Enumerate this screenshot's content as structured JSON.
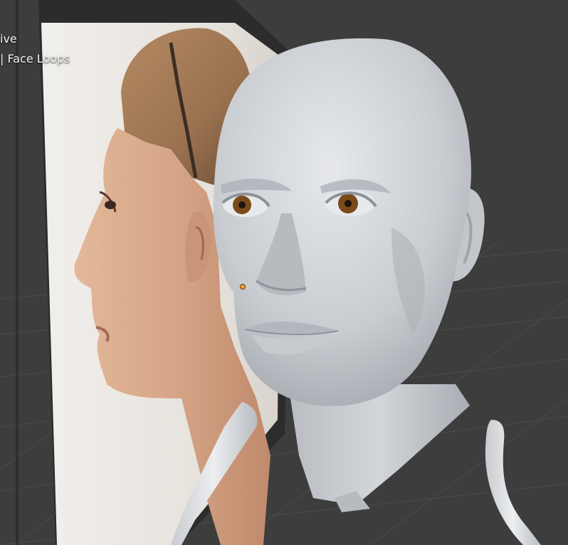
{
  "viewport": {
    "view_mode_text": "ive",
    "edit_mode_text": "| Face Loops"
  },
  "colors": {
    "background": "#3d3d3d",
    "grid_line": "#4a4a4a",
    "reference_plane": "#e9e6e2",
    "mesh": "#c9ccd0",
    "iris": "#7a4a18",
    "selected_vertex": "#f0a030"
  },
  "objects": {
    "reference_image": "side-profile-reference",
    "head_mesh": "sculpted-head",
    "cutter_curves": "white-curves"
  }
}
